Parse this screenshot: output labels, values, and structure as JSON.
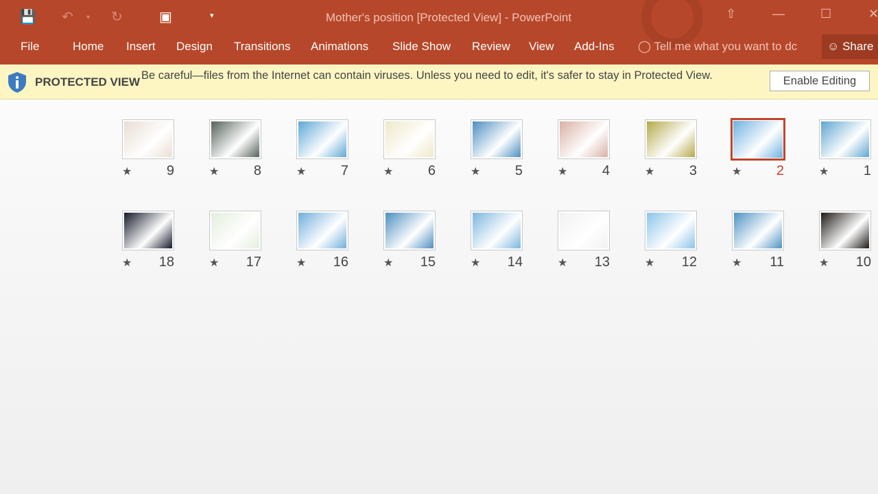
{
  "window": {
    "title": "Mother's position [Protected View] - PowerPoint"
  },
  "qat": {
    "icons": [
      "save-icon",
      "undo-icon",
      "redo-icon",
      "present-icon",
      "customize-icon"
    ]
  },
  "menu": [
    "File",
    "Home",
    "Insert",
    "Design",
    "Transitions",
    "Animations",
    "Slide Show",
    "Review",
    "View",
    "Add-Ins"
  ],
  "tell_me": "Tell me what you want to dc",
  "share": "Share",
  "protected": {
    "title": "PROTECTED VIEW",
    "message": "Be careful—files from the Internet can contain viruses. Unless you need to edit, it's safer to stay in Protected View.",
    "button": "Enable Editing"
  },
  "accent": "#b7472a",
  "selected_slide": "2",
  "slides": [
    {
      "n": "1",
      "color": "#5fa6d0"
    },
    {
      "n": "2",
      "color": "#6fb2e0"
    },
    {
      "n": "3",
      "color": "#b5a94a"
    },
    {
      "n": "4",
      "color": "#d9b0a5"
    },
    {
      "n": "5",
      "color": "#4d8fc0"
    },
    {
      "n": "6",
      "color": "#efe8c8"
    },
    {
      "n": "7",
      "color": "#5ea8d6"
    },
    {
      "n": "8",
      "color": "#55625a"
    },
    {
      "n": "9",
      "color": "#e9ded3"
    },
    {
      "n": "10",
      "color": "#1e1a16"
    },
    {
      "n": "11",
      "color": "#4f93c2"
    },
    {
      "n": "12",
      "color": "#8cc4ea"
    },
    {
      "n": "13",
      "color": "#f2f2f2"
    },
    {
      "n": "14",
      "color": "#7db6de"
    },
    {
      "n": "15",
      "color": "#4e8fbf"
    },
    {
      "n": "16",
      "color": "#72aedb"
    },
    {
      "n": "17",
      "color": "#e4eedf"
    },
    {
      "n": "18",
      "color": "#15192a"
    }
  ]
}
